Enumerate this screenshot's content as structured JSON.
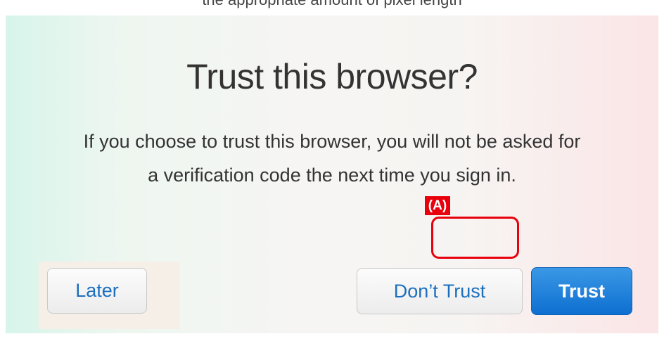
{
  "header": {
    "cut_text": "the appropriate amount of pixel length"
  },
  "dialog": {
    "title": "Trust this browser?",
    "description": "If you choose to trust this browser, you will not be asked for a verification code the next time you sign in."
  },
  "buttons": {
    "later_label": "Later",
    "dont_trust_label": "Don’t Trust",
    "trust_label": "Trust"
  },
  "annotation": {
    "label": "(A)",
    "color": "#e8000c"
  },
  "colors": {
    "link_blue": "#1c6fbe",
    "primary_blue": "#0d6fd0",
    "text_dark": "#333333"
  }
}
